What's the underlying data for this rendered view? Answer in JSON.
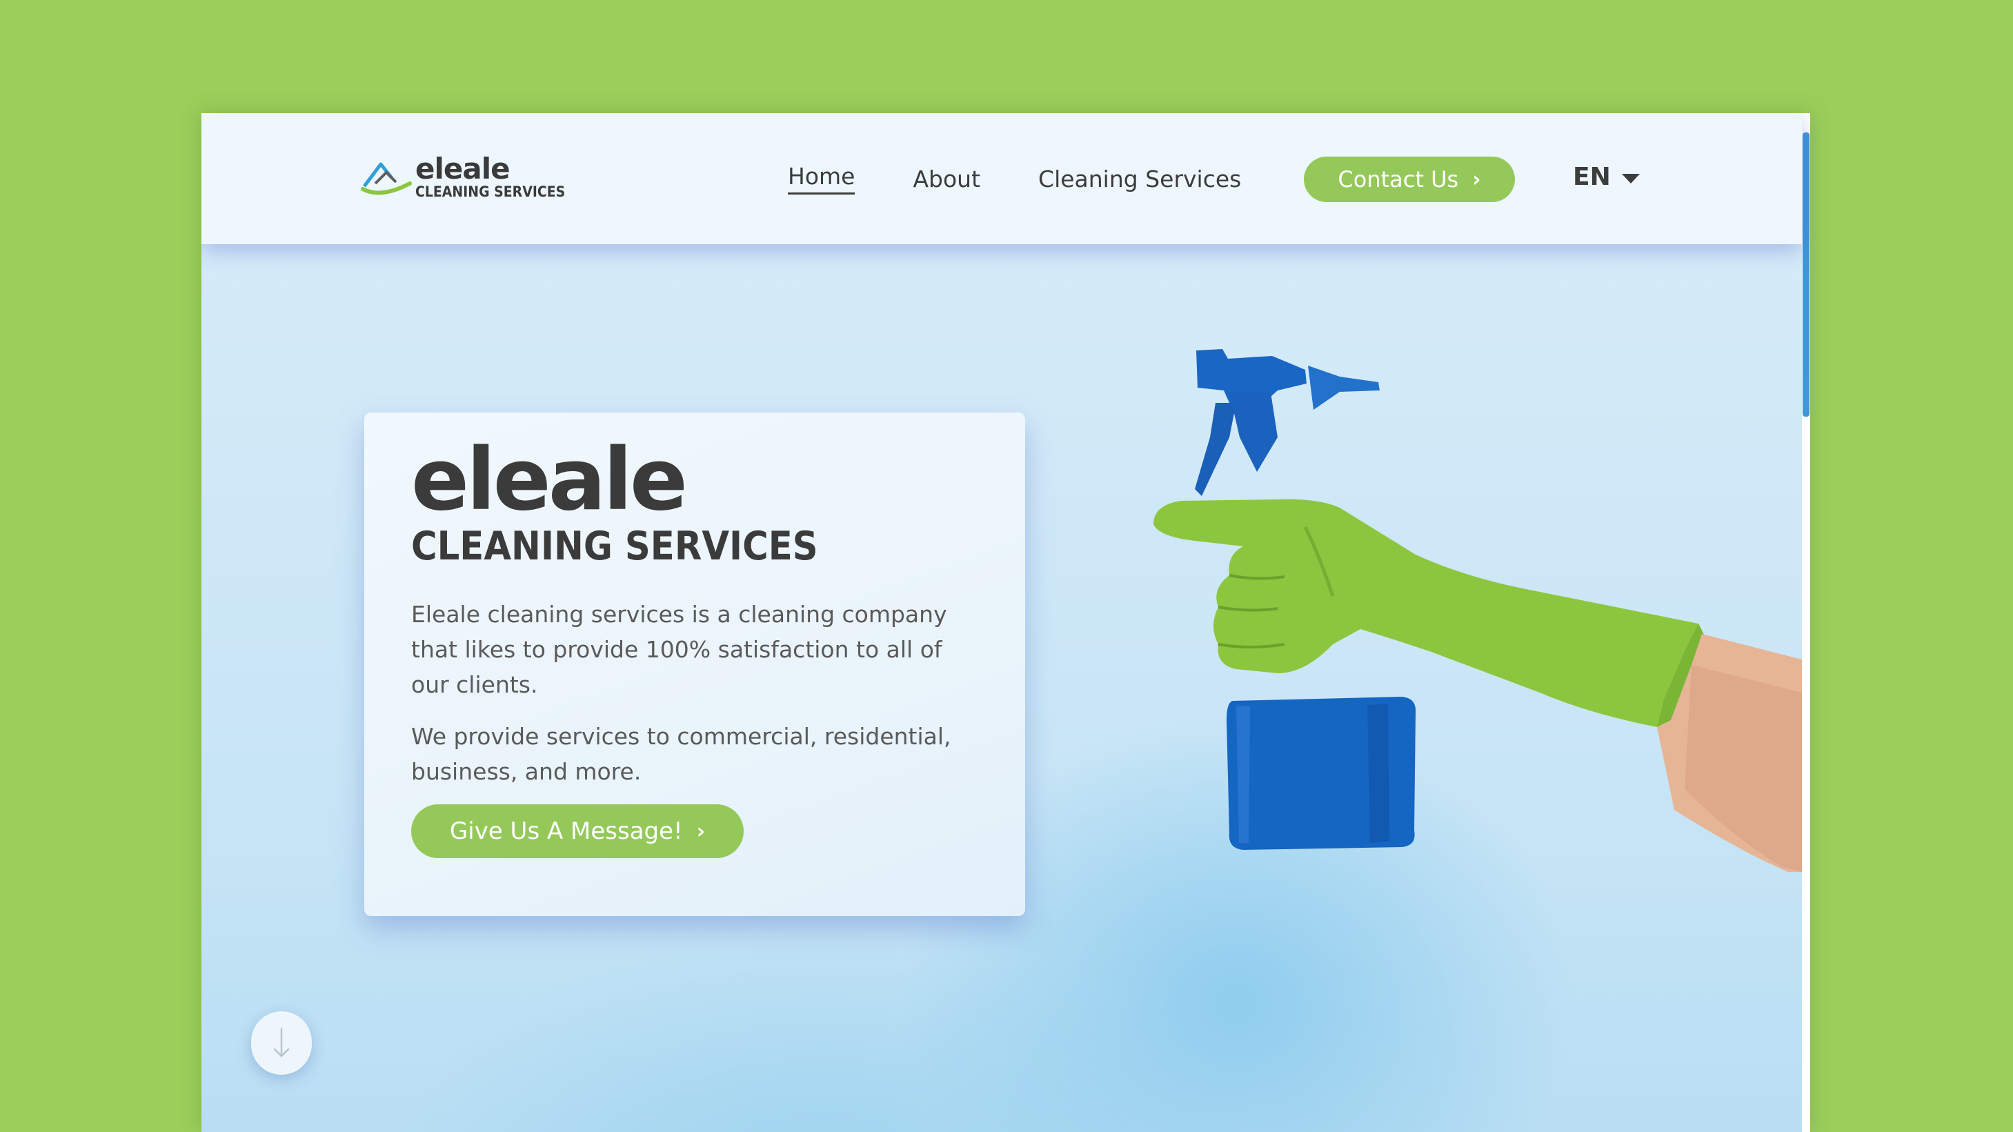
{
  "brand": {
    "name": "eleale",
    "tagline": "CLEANING SERVICES",
    "logo_icon": "house-roof-icon"
  },
  "nav": {
    "items": [
      {
        "label": "Home",
        "active": true
      },
      {
        "label": "About",
        "active": false
      },
      {
        "label": "Cleaning Services",
        "active": false
      }
    ],
    "contact_label": "Contact Us",
    "language": "EN"
  },
  "hero": {
    "title": "eleale",
    "subtitle": "CLEANING SERVICES",
    "paragraph1": "Eleale cleaning services is a cleaning company that likes to provide 100% satisfaction to all of our clients.",
    "paragraph2": "We provide services to commercial, residential, business, and more.",
    "cta_label": "Give Us A Message!",
    "image": "gloved-hand-spray-bottle"
  },
  "scroll_down_icon": "arrow-down-icon",
  "colors": {
    "page_background": "#9bcf5b",
    "accent_green": "#94c95a",
    "text_dark": "#3b3b3b",
    "scrollbar": "#3c98d6",
    "bottle_blue": "#1564c0"
  }
}
